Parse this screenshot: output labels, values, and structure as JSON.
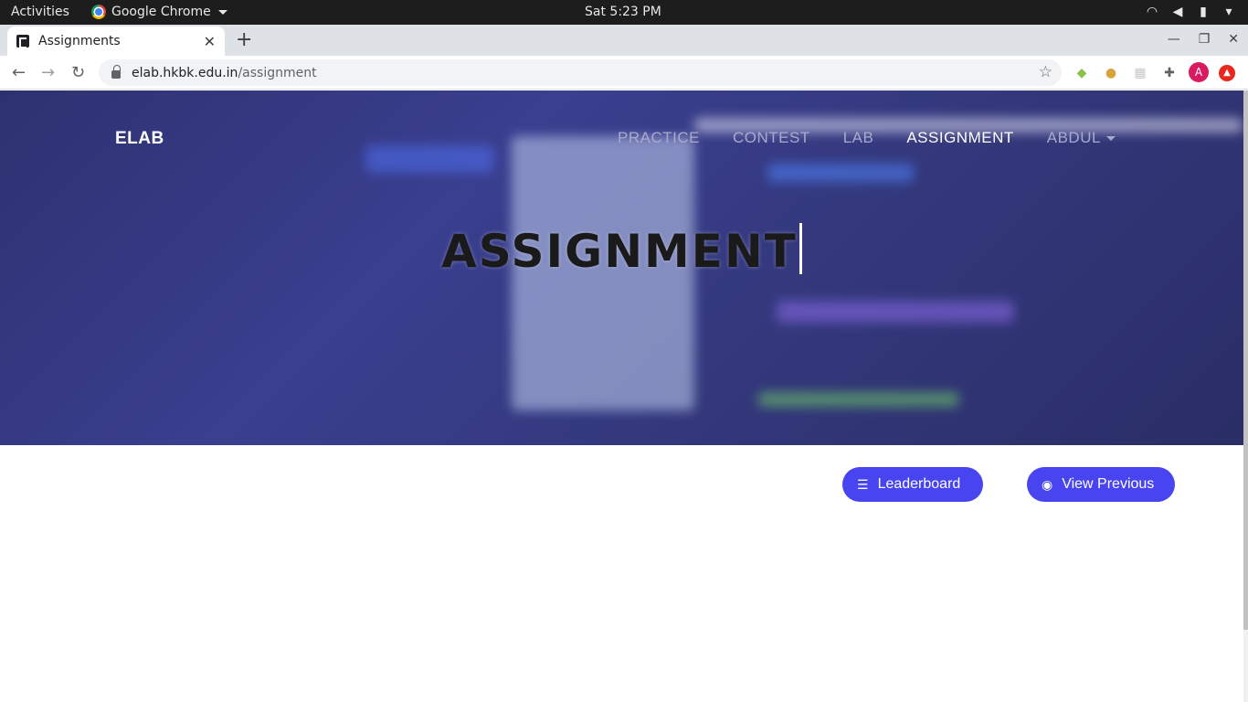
{
  "os": {
    "activities": "Activities",
    "app_name": "Google Chrome",
    "clock": "Sat  5:23 PM"
  },
  "browser": {
    "tab_title": "Assignments",
    "url_host": "elab.hkbk.edu.in",
    "url_path": "/assignment",
    "avatar_letter": "A"
  },
  "page": {
    "brand": "ELAB",
    "nav": {
      "practice": "PRACTICE",
      "contest": "CONTEST",
      "lab": "LAB",
      "assignment": "ASSIGNMENT",
      "user": "ABDUL"
    },
    "hero_title": "ASSIGNMENT",
    "buttons": {
      "leaderboard": "Leaderboard",
      "view_previous": "View Previous"
    }
  },
  "colors": {
    "accent": "#4744f0",
    "hero": "#34397e"
  }
}
